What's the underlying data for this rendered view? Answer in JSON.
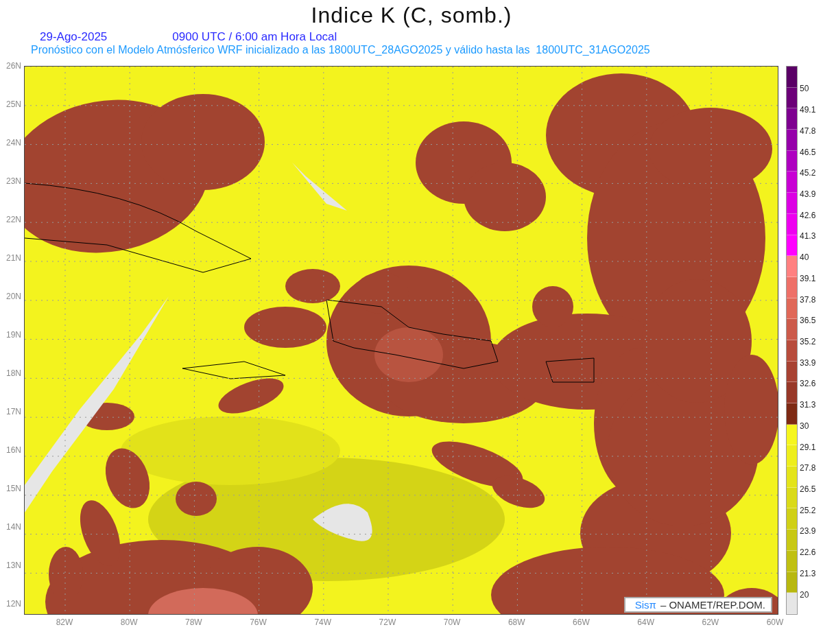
{
  "title": "Indice K (C, somb.)",
  "date": "29-Ago-2025",
  "time": "0900 UTC / 6:00 am Hora Local",
  "subtitle": "Pronóstico con el Modelo Atmósferico WRF inicializado a las 1800UTC_28AGO2025 y válido hasta las  1800UTC_31AGO2025",
  "y_ticks": [
    "26N",
    "25N",
    "24N",
    "23N",
    "22N",
    "21N",
    "20N",
    "19N",
    "18N",
    "17N",
    "16N",
    "15N",
    "14N",
    "13N",
    "12N"
  ],
  "x_ticks": [
    "82W",
    "80W",
    "78W",
    "76W",
    "74W",
    "72W",
    "70W",
    "68W",
    "66W",
    "64W",
    "62W",
    "60W"
  ],
  "colorbar": {
    "cells": [
      {
        "color": "#5a0066"
      },
      {
        "color": "#6c0078"
      },
      {
        "color": "#7e0090"
      },
      {
        "color": "#9600aa"
      },
      {
        "color": "#ae00c0"
      },
      {
        "color": "#c800d4"
      },
      {
        "color": "#dc00e4"
      },
      {
        "color": "#ee00f0"
      },
      {
        "color": "#ff00ff"
      },
      {
        "color": "#ff8080"
      },
      {
        "color": "#ee7068"
      },
      {
        "color": "#e06858"
      },
      {
        "color": "#cc5a4a"
      },
      {
        "color": "#b84c3c"
      },
      {
        "color": "#a84232"
      },
      {
        "color": "#983828"
      },
      {
        "color": "#7e2a14"
      },
      {
        "color": "#f6f61e"
      },
      {
        "color": "#eeee1c"
      },
      {
        "color": "#e4e41a"
      },
      {
        "color": "#dada18"
      },
      {
        "color": "#d0d016"
      },
      {
        "color": "#c8c814"
      },
      {
        "color": "#c0c012"
      },
      {
        "color": "#b8b810"
      },
      {
        "color": "#e6e6e6"
      }
    ],
    "labels": [
      "50",
      "49.1",
      "47.8",
      "46.5",
      "45.2",
      "43.9",
      "42.6",
      "41.3",
      "40",
      "39.1",
      "37.8",
      "36.5",
      "35.2",
      "33.9",
      "32.6",
      "31.3",
      "30",
      "29.1",
      "27.8",
      "26.5",
      "25.2",
      "23.9",
      "22.6",
      "21.3",
      "20"
    ]
  },
  "credit": {
    "logo": "Sisπ",
    "text": "– ONAMET/REP.DOM."
  }
}
